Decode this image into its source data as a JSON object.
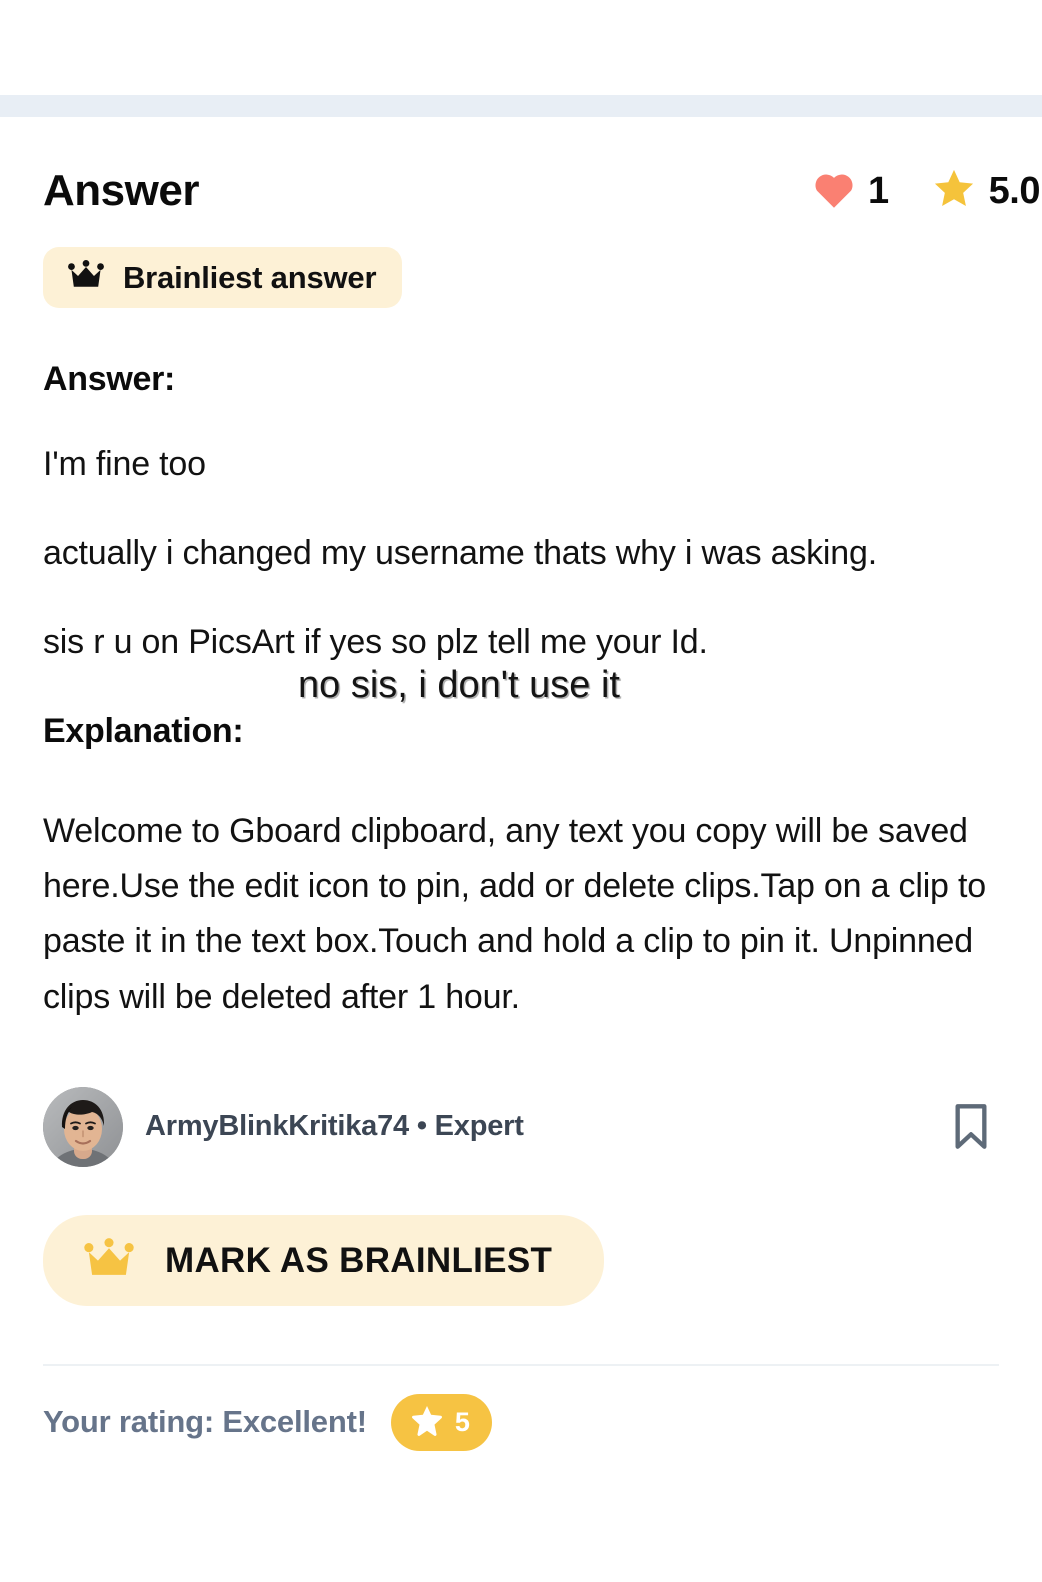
{
  "colors": {
    "page_background": "#ffffff",
    "status_band": "#e8eef5",
    "badge_background": "#fdf1d6",
    "heart": "#fa8072",
    "star": "#f5c33b",
    "rating_pill": "#f6c343",
    "rating_text": "#66748a",
    "author_text": "#3c4654",
    "bookmark": "#5e6a78",
    "crown_yellow": "#f6c343",
    "crown_black": "#111111"
  },
  "header": {
    "title": "Answer",
    "stats": [
      {
        "icon": "heart-icon",
        "value": "1"
      },
      {
        "icon": "star-icon",
        "value": "5.0"
      }
    ]
  },
  "brainliest_badge": {
    "icon": "crown-icon",
    "label": "Brainliest answer"
  },
  "answer": {
    "heading": "Answer:",
    "paragraphs": [
      "I'm fine too",
      "actually i changed my username thats why i was asking.",
      "sis r u on PicsArt if yes so plz tell me your Id."
    ]
  },
  "overlay_note": {
    "text": "no sis, i don't use it"
  },
  "explanation": {
    "heading": "Explanation:",
    "body": "Welcome to Gboard clipboard, any text you copy will be saved here.Use the edit icon to pin, add or delete clips.Tap on a clip to paste it in the text box.Touch and hold a clip to pin it. Unpinned clips will be deleted after 1 hour."
  },
  "author": {
    "avatar_alt": "user-avatar",
    "name": "ArmyBlinkKritika74 • Expert",
    "bookmark_icon": "bookmark-icon"
  },
  "mark_brainliest": {
    "icon": "crown-icon",
    "label": "MARK AS BRAINLIEST"
  },
  "rating": {
    "label": "Your rating: Excellent!",
    "value": "5",
    "icon": "star-icon"
  }
}
